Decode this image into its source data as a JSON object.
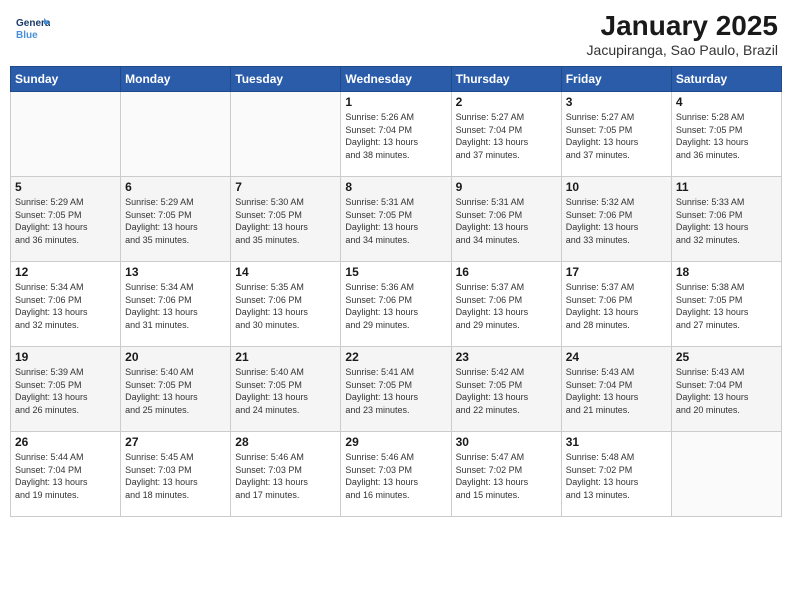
{
  "header": {
    "logo_text_general": "General",
    "logo_text_blue": "Blue",
    "title": "January 2025",
    "subtitle": "Jacupiranga, Sao Paulo, Brazil"
  },
  "days_of_week": [
    "Sunday",
    "Monday",
    "Tuesday",
    "Wednesday",
    "Thursday",
    "Friday",
    "Saturday"
  ],
  "weeks": [
    [
      {
        "day": "",
        "info": ""
      },
      {
        "day": "",
        "info": ""
      },
      {
        "day": "",
        "info": ""
      },
      {
        "day": "1",
        "info": "Sunrise: 5:26 AM\nSunset: 7:04 PM\nDaylight: 13 hours\nand 38 minutes."
      },
      {
        "day": "2",
        "info": "Sunrise: 5:27 AM\nSunset: 7:04 PM\nDaylight: 13 hours\nand 37 minutes."
      },
      {
        "day": "3",
        "info": "Sunrise: 5:27 AM\nSunset: 7:05 PM\nDaylight: 13 hours\nand 37 minutes."
      },
      {
        "day": "4",
        "info": "Sunrise: 5:28 AM\nSunset: 7:05 PM\nDaylight: 13 hours\nand 36 minutes."
      }
    ],
    [
      {
        "day": "5",
        "info": "Sunrise: 5:29 AM\nSunset: 7:05 PM\nDaylight: 13 hours\nand 36 minutes."
      },
      {
        "day": "6",
        "info": "Sunrise: 5:29 AM\nSunset: 7:05 PM\nDaylight: 13 hours\nand 35 minutes."
      },
      {
        "day": "7",
        "info": "Sunrise: 5:30 AM\nSunset: 7:05 PM\nDaylight: 13 hours\nand 35 minutes."
      },
      {
        "day": "8",
        "info": "Sunrise: 5:31 AM\nSunset: 7:05 PM\nDaylight: 13 hours\nand 34 minutes."
      },
      {
        "day": "9",
        "info": "Sunrise: 5:31 AM\nSunset: 7:06 PM\nDaylight: 13 hours\nand 34 minutes."
      },
      {
        "day": "10",
        "info": "Sunrise: 5:32 AM\nSunset: 7:06 PM\nDaylight: 13 hours\nand 33 minutes."
      },
      {
        "day": "11",
        "info": "Sunrise: 5:33 AM\nSunset: 7:06 PM\nDaylight: 13 hours\nand 32 minutes."
      }
    ],
    [
      {
        "day": "12",
        "info": "Sunrise: 5:34 AM\nSunset: 7:06 PM\nDaylight: 13 hours\nand 32 minutes."
      },
      {
        "day": "13",
        "info": "Sunrise: 5:34 AM\nSunset: 7:06 PM\nDaylight: 13 hours\nand 31 minutes."
      },
      {
        "day": "14",
        "info": "Sunrise: 5:35 AM\nSunset: 7:06 PM\nDaylight: 13 hours\nand 30 minutes."
      },
      {
        "day": "15",
        "info": "Sunrise: 5:36 AM\nSunset: 7:06 PM\nDaylight: 13 hours\nand 29 minutes."
      },
      {
        "day": "16",
        "info": "Sunrise: 5:37 AM\nSunset: 7:06 PM\nDaylight: 13 hours\nand 29 minutes."
      },
      {
        "day": "17",
        "info": "Sunrise: 5:37 AM\nSunset: 7:06 PM\nDaylight: 13 hours\nand 28 minutes."
      },
      {
        "day": "18",
        "info": "Sunrise: 5:38 AM\nSunset: 7:05 PM\nDaylight: 13 hours\nand 27 minutes."
      }
    ],
    [
      {
        "day": "19",
        "info": "Sunrise: 5:39 AM\nSunset: 7:05 PM\nDaylight: 13 hours\nand 26 minutes."
      },
      {
        "day": "20",
        "info": "Sunrise: 5:40 AM\nSunset: 7:05 PM\nDaylight: 13 hours\nand 25 minutes."
      },
      {
        "day": "21",
        "info": "Sunrise: 5:40 AM\nSunset: 7:05 PM\nDaylight: 13 hours\nand 24 minutes."
      },
      {
        "day": "22",
        "info": "Sunrise: 5:41 AM\nSunset: 7:05 PM\nDaylight: 13 hours\nand 23 minutes."
      },
      {
        "day": "23",
        "info": "Sunrise: 5:42 AM\nSunset: 7:05 PM\nDaylight: 13 hours\nand 22 minutes."
      },
      {
        "day": "24",
        "info": "Sunrise: 5:43 AM\nSunset: 7:04 PM\nDaylight: 13 hours\nand 21 minutes."
      },
      {
        "day": "25",
        "info": "Sunrise: 5:43 AM\nSunset: 7:04 PM\nDaylight: 13 hours\nand 20 minutes."
      }
    ],
    [
      {
        "day": "26",
        "info": "Sunrise: 5:44 AM\nSunset: 7:04 PM\nDaylight: 13 hours\nand 19 minutes."
      },
      {
        "day": "27",
        "info": "Sunrise: 5:45 AM\nSunset: 7:03 PM\nDaylight: 13 hours\nand 18 minutes."
      },
      {
        "day": "28",
        "info": "Sunrise: 5:46 AM\nSunset: 7:03 PM\nDaylight: 13 hours\nand 17 minutes."
      },
      {
        "day": "29",
        "info": "Sunrise: 5:46 AM\nSunset: 7:03 PM\nDaylight: 13 hours\nand 16 minutes."
      },
      {
        "day": "30",
        "info": "Sunrise: 5:47 AM\nSunset: 7:02 PM\nDaylight: 13 hours\nand 15 minutes."
      },
      {
        "day": "31",
        "info": "Sunrise: 5:48 AM\nSunset: 7:02 PM\nDaylight: 13 hours\nand 13 minutes."
      },
      {
        "day": "",
        "info": ""
      }
    ]
  ]
}
